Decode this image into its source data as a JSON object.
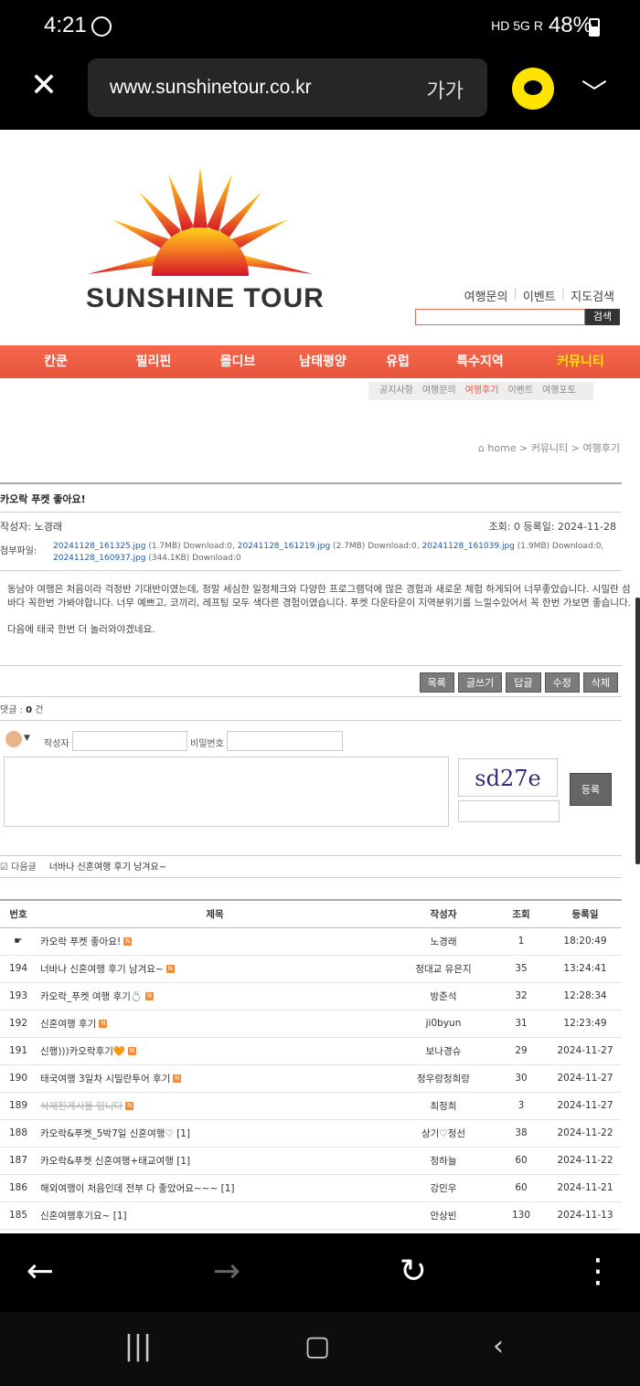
{
  "status_bar": {
    "time": "4:21",
    "battery": "48%",
    "icons": "HD 5G R"
  },
  "url_bar": {
    "url": "www.sunshinetour.co.kr",
    "font_size_label": "가가"
  },
  "header": {
    "brand": "SUNSHINE TOUR",
    "top_links": [
      "여행문의",
      "이벤트",
      "지도검색"
    ],
    "search_button": "검색"
  },
  "main_nav": [
    "칸쿤",
    "필리핀",
    "몰디브",
    "남태평양",
    "유럽",
    "특수지역",
    "커뮤니티"
  ],
  "sub_nav": [
    "공지사항",
    "여행문의",
    "여행후기",
    "이벤트",
    "여행포토"
  ],
  "breadcrumb": "home > 커뮤니티 > 여행후기",
  "post": {
    "title": "카오락 푸켓 좋아요!",
    "author_label": "작성자:",
    "author": "노경래",
    "meta": "조회: 0  등록일: 2024-11-28",
    "attach_label": "첨부파일:",
    "attachments": [
      {
        "name": "20241128_161325.jpg",
        "size": "(1.7MB)",
        "dl": "Download:0,"
      },
      {
        "name": "20241128_161219.jpg",
        "size": "(2.7MB)",
        "dl": "Download:0,"
      },
      {
        "name": "20241128_161039.jpg",
        "size": "(1.9MB)",
        "dl": "Download:0,"
      },
      {
        "name": "20241128_160937.jpg",
        "size": "(344.1KB)",
        "dl": "Download:0"
      }
    ],
    "body_1": "동남아 여행은 처음이라 걱정반 기대반이였는데, 정말 세심한 일정체크와 다양한 프로그램덕에 많은 경험과 새로운 체험 하게되어 너무좋았습니다. 시밀란 섬 바다 꼭한번 가봐야합니다. 너무 예쁘고, 코끼리, 레프팅 모두 색다른 경험이였습니다.  푸켓 다운타운이 지역분위기를 느낄수있어서 꼭 한번 가보면 좋습니다.",
    "body_2": "다음에 태국 한번 더 놀러와야겠네요."
  },
  "buttons": [
    "목록",
    "글쓰기",
    "답글",
    "수정",
    "삭제"
  ],
  "comments": {
    "count_label": "댓글 :",
    "count": "0",
    "count_unit": "건",
    "writer_label": "작성자",
    "password_label": "비밀번호",
    "captcha": "sd27e",
    "submit": "등록"
  },
  "next_post": {
    "label": "다음글",
    "title": "너바나 신혼여행 후기 남겨요~"
  },
  "table": {
    "headers": [
      "번호",
      "제목",
      "작성자",
      "조회",
      "등록일"
    ],
    "rows": [
      {
        "num": "☛",
        "title": "카오락 푸켓 좋아요!",
        "new": true,
        "writer": "노경래",
        "views": "1",
        "date": "18:20:49"
      },
      {
        "num": "194",
        "title": "너바나 신혼여행 후기 남겨요~",
        "new": true,
        "writer": "정대교 유은지",
        "views": "35",
        "date": "13:24:41"
      },
      {
        "num": "193",
        "title": "카오락_푸켓 여행 후기💍",
        "new": true,
        "writer": "방준석",
        "views": "32",
        "date": "12:28:34"
      },
      {
        "num": "192",
        "title": "신혼여행 후기",
        "new": true,
        "writer": "ji0byun",
        "views": "31",
        "date": "12:23:49"
      },
      {
        "num": "191",
        "title": "신행)))카오락후기🧡",
        "new": true,
        "writer": "보나경슈",
        "views": "29",
        "date": "2024-11-27"
      },
      {
        "num": "190",
        "title": "태국여행 3일차 시밀란투어 후기",
        "new": true,
        "writer": "정우랑정희랑",
        "views": "30",
        "date": "2024-11-27"
      },
      {
        "num": "189",
        "title": "삭제된게시물 입니다",
        "new": true,
        "deleted": true,
        "writer": "최정희",
        "views": "3",
        "date": "2024-11-27"
      },
      {
        "num": "188",
        "title": "카오락&푸켓_5박7일 신혼여행♡ [1]",
        "writer": "상기♡정선",
        "views": "38",
        "date": "2024-11-22"
      },
      {
        "num": "187",
        "title": "카오락&푸켓 신혼여행+태교여행 [1]",
        "writer": "정하늘",
        "views": "60",
        "date": "2024-11-22"
      },
      {
        "num": "186",
        "title": "해외여행이 처음인데 전부 다 좋았어요~~~ [1]",
        "writer": "강민우",
        "views": "60",
        "date": "2024-11-21"
      },
      {
        "num": "185",
        "title": "신혼여행후기요~ [1]",
        "writer": "안상빈",
        "views": "130",
        "date": "2024-11-13"
      }
    ]
  },
  "colors": {
    "nav": "#f0603f",
    "nav_active": "#ffe600",
    "link": "#1f5ba8",
    "badge": "#f08a3c"
  }
}
